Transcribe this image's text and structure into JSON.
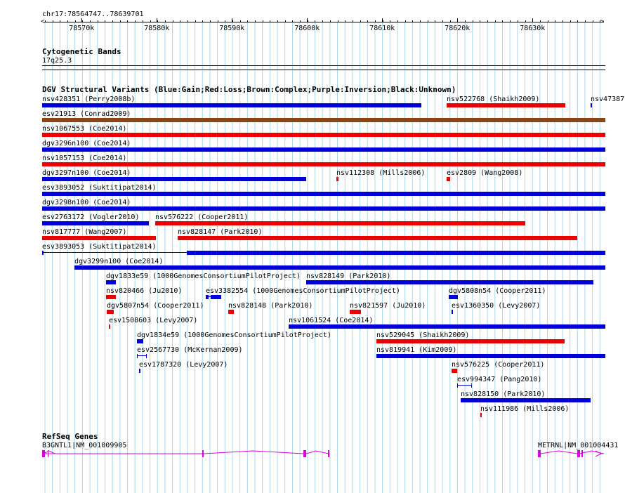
{
  "colors": {
    "gain": "#0000dd",
    "loss": "#ee0000",
    "complex": "#8b4513",
    "gene": "#dd00dd",
    "grid": "#a8d8e8"
  },
  "ruler": {
    "region_label": "chr17:78564747..78639701",
    "start": 78564747,
    "end": 78639701,
    "ticks": [
      {
        "pos": 78570000,
        "label": "78570k"
      },
      {
        "pos": 78580000,
        "label": "78580k"
      },
      {
        "pos": 78590000,
        "label": "78590k"
      },
      {
        "pos": 78600000,
        "label": "78600k"
      },
      {
        "pos": 78610000,
        "label": "78610k"
      },
      {
        "pos": 78620000,
        "label": "78620k"
      },
      {
        "pos": 78630000,
        "label": "78630k"
      }
    ]
  },
  "cytobands": {
    "title": "Cytogenetic Bands",
    "band": "17q25.3"
  },
  "dgv": {
    "title": "DGV Structural Variants (Blue:Gain;Red:Loss;Brown:Complex;Purple:Inversion;Black:Unknown)",
    "features": [
      {
        "label": "nsv428351 (Perry2008b)",
        "type": "gain"
      },
      {
        "label": "nsv522768 (Shaikh2009)",
        "type": "loss"
      },
      {
        "label": "nsv47387",
        "type": "gain"
      },
      {
        "label": "esv21913 (Conrad2009)",
        "type": "complex"
      },
      {
        "label": "nsv1067553 (Coe2014)",
        "type": "loss"
      },
      {
        "label": "dgv3296n100 (Coe2014)",
        "type": "gain"
      },
      {
        "label": "nsv1057153 (Coe2014)",
        "type": "loss"
      },
      {
        "label": "dgv3297n100 (Coe2014)",
        "type": "gain"
      },
      {
        "label": "nsv112308 (Mills2006)",
        "type": "loss"
      },
      {
        "label": "esv2809 (Wang2008)",
        "type": "loss"
      },
      {
        "label": "esv3893052 (Suktitipat2014)",
        "type": "gain"
      },
      {
        "label": "dgv3298n100 (Coe2014)",
        "type": "gain"
      },
      {
        "label": "esv2763172 (Vogler2010)",
        "type": "gain"
      },
      {
        "label": "nsv576222 (Cooper2011)",
        "type": "loss"
      },
      {
        "label": "nsv817777 (Wang2007)",
        "type": "loss"
      },
      {
        "label": "nsv828147 (Park2010)",
        "type": "loss"
      },
      {
        "label": "esv3893053 (Suktitipat2014)",
        "type": "gain"
      },
      {
        "label": "dgv3299n100 (Coe2014)",
        "type": "gain"
      },
      {
        "label": "dgv1833e59 (1000GenomesConsortiumPilotProject)",
        "type": "gain"
      },
      {
        "label": "nsv828149 (Park2010)",
        "type": "gain"
      },
      {
        "label": "nsv820466 (Ju2010)",
        "type": "loss"
      },
      {
        "label": "esv3382554 (1000GenomesConsortiumPilotProject)",
        "type": "gain"
      },
      {
        "label": "dgv5808n54 (Cooper2011)",
        "type": "gain"
      },
      {
        "label": "dgv5807n54 (Cooper2011)",
        "type": "loss"
      },
      {
        "label": "nsv828148 (Park2010)",
        "type": "loss"
      },
      {
        "label": "nsv821597 (Ju2010)",
        "type": "loss"
      },
      {
        "label": "esv1360350 (Levy2007)",
        "type": "gain"
      },
      {
        "label": "esv1508603 (Levy2007)",
        "type": "loss"
      },
      {
        "label": "nsv1061524 (Coe2014)",
        "type": "gain"
      },
      {
        "label": "dgv1834e59 (1000GenomesConsortiumPilotProject)",
        "type": "gain"
      },
      {
        "label": "nsv529045 (Shaikh2009)",
        "type": "loss"
      },
      {
        "label": "esv2567730 (McKernan2009)",
        "type": "gain"
      },
      {
        "label": "nsv819941 (Kim2009)",
        "type": "gain"
      },
      {
        "label": "esv1787320 (Levy2007)",
        "type": "gain"
      },
      {
        "label": "nsv576225 (Cooper2011)",
        "type": "loss"
      },
      {
        "label": "esv994347 (Pang2010)",
        "type": "gain"
      },
      {
        "label": "nsv828150 (Park2010)",
        "type": "gain"
      },
      {
        "label": "nsv111986 (Mills2006)",
        "type": "loss"
      }
    ]
  },
  "refseq": {
    "title": "RefSeq Genes",
    "genes": [
      {
        "label": "B3GNTL1|NM_001009905"
      },
      {
        "label": "METRNL|NM_001004431"
      }
    ]
  }
}
